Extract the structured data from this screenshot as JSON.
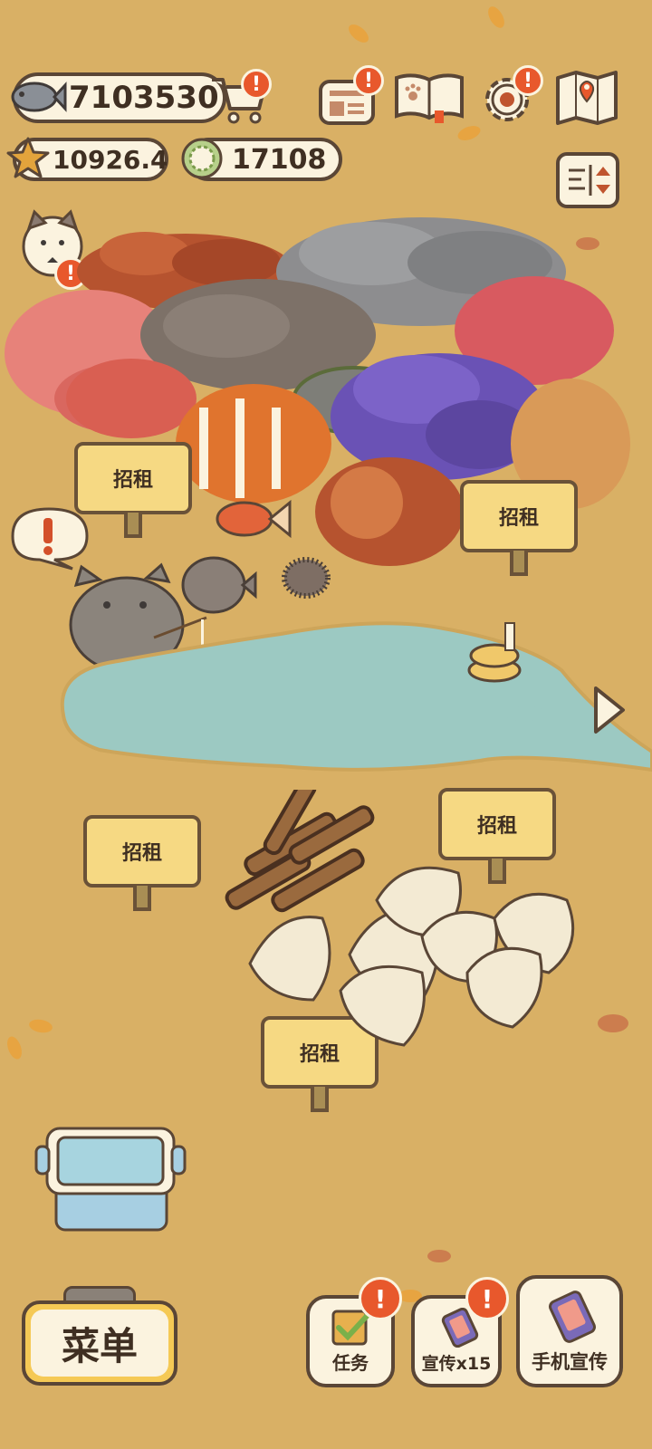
{
  "currency": {
    "fish": "7103530",
    "stars": "10926.4",
    "coins": "17108"
  },
  "badges": {
    "alert": "!"
  },
  "signs": {
    "rent_label": "招租"
  },
  "bottom_bar": {
    "menu_label": "菜单",
    "tasks_label": "任务",
    "promote_label": "宣传x15",
    "phone_promote_label": "手机宣传"
  },
  "icons": {
    "fish": "fish-icon",
    "shop": "shopping-cart-icon",
    "news": "newspaper-icon",
    "book": "paw-book-icon",
    "settings": "gear-icon",
    "map": "map-icon",
    "sort": "sort-toggle-icon",
    "next": "chevron-right-icon"
  },
  "colors": {
    "ground": "#d9b065",
    "water": "#9cc9c2",
    "alert": "#e8582c",
    "panel": "#fbf3df",
    "outline": "#5a4636"
  }
}
